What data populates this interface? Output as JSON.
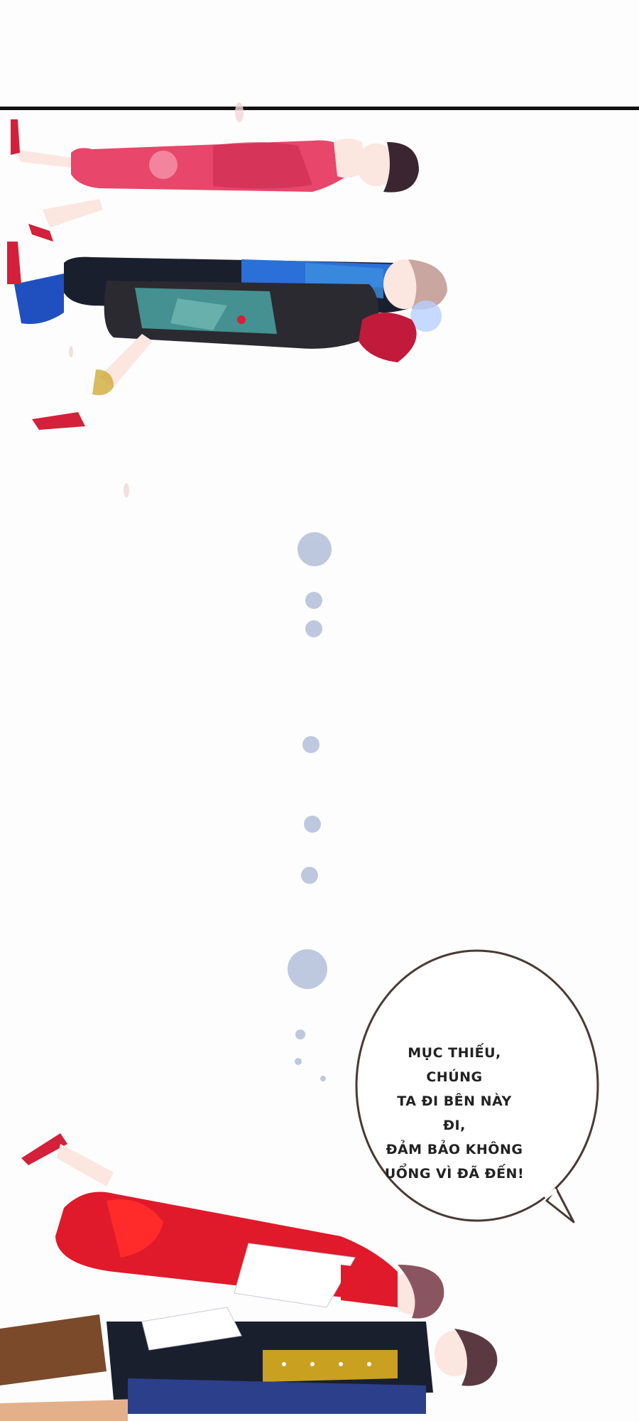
{
  "comic": {
    "speech_bubble": {
      "lines": [
        "MỤC THIẾU, CHÚNG",
        "TA ĐI BÊN NÀY ĐI,",
        "ĐẢM BẢO KHÔNG",
        "UỔNG VÌ ĐÃ ĐẾN!"
      ]
    },
    "colors": {
      "background": "#fdfdfd",
      "border": "#111111",
      "bubble_outline": "#4a3a33",
      "pink_dress": "#e8466a",
      "red_dress": "#e01a2a",
      "blue_suit": "#2b6fd8",
      "teal_dress": "#4fb3b0",
      "hair_dark": "#3a2530",
      "mustard": "#c9a020"
    }
  }
}
